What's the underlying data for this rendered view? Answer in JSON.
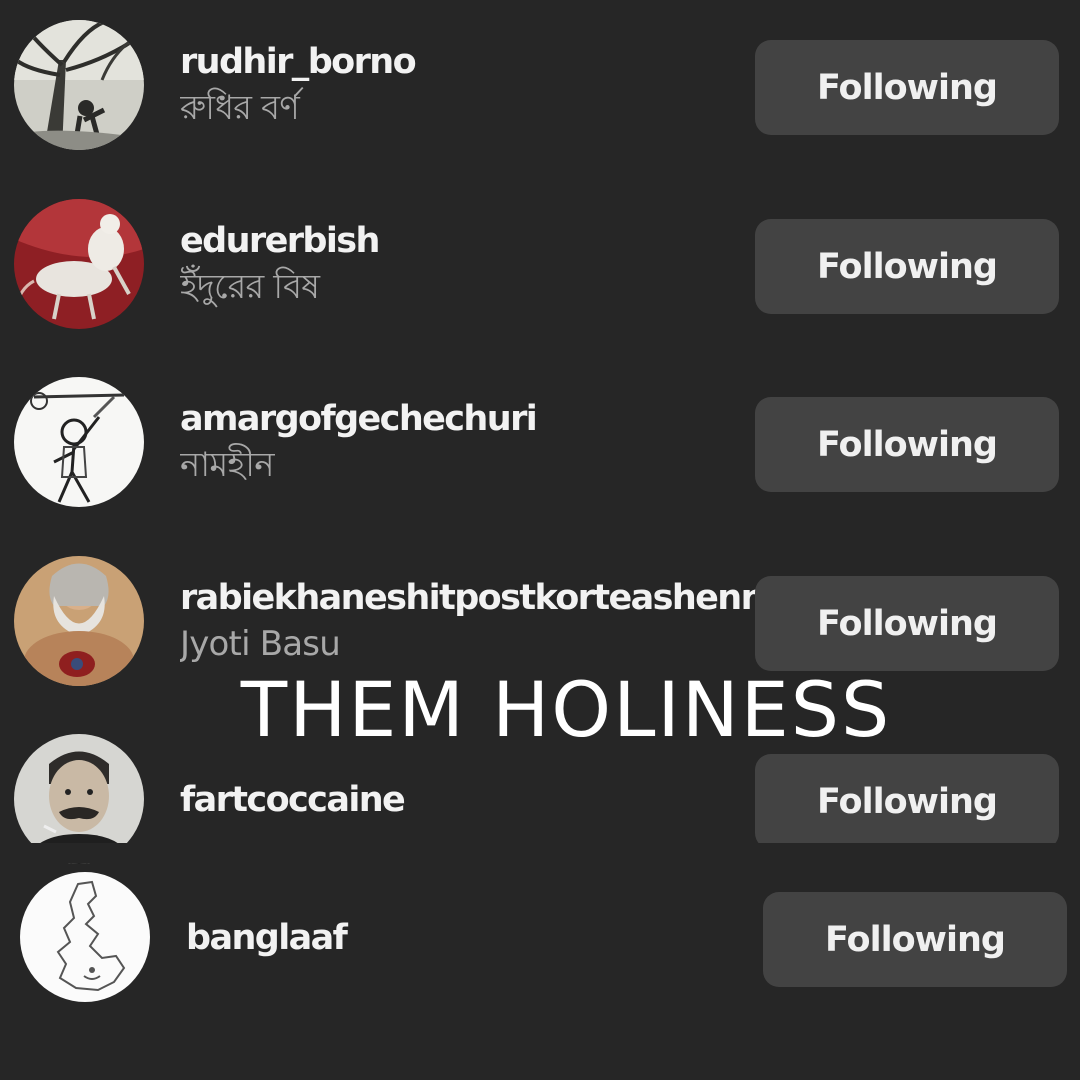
{
  "following_list": {
    "accounts": [
      {
        "username": "rudhir_borno",
        "full_name": "রুধির বর্ণ",
        "button_label": "Following",
        "avatar_icon": "tree-figure-avatar-icon"
      },
      {
        "username": "edurerbish",
        "full_name": "ইঁদুরের বিষ",
        "button_label": "Following",
        "avatar_icon": "rat-avatar-icon"
      },
      {
        "username": "amargofgechechuri",
        "full_name": "নামহীন",
        "button_label": "Following",
        "avatar_icon": "sketch-man-avatar-icon"
      },
      {
        "username": "rabiekhaneshitpostkorteashenni",
        "full_name": "Jyoti Basu",
        "button_label": "Following",
        "avatar_icon": "bearded-man-avatar-icon"
      },
      {
        "username": "fartcoccaine",
        "full_name": "",
        "button_label": "Following",
        "avatar_icon": "mustache-man-avatar-icon"
      },
      {
        "username": "banglaaf",
        "full_name": "",
        "button_label": "Following",
        "avatar_icon": "map-outline-avatar-icon"
      }
    ]
  },
  "overlay": {
    "caption": "THEM HOLINESS"
  },
  "colors": {
    "background": "#262626",
    "button": "#434343",
    "primary_text": "#f2f2f2",
    "secondary_text": "#a8a8a8"
  }
}
